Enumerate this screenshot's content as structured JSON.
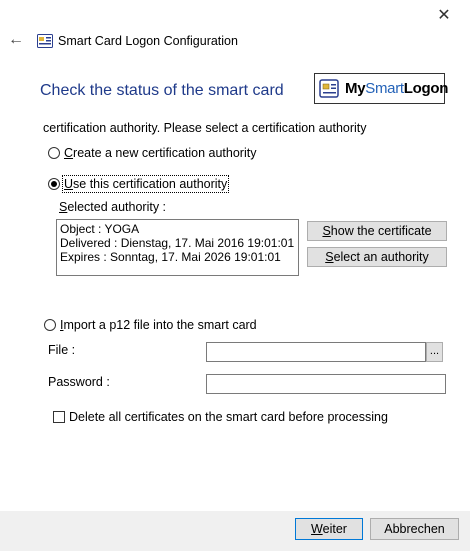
{
  "window": {
    "title": "Smart Card Logon Configuration",
    "close_glyph": "✕",
    "back_glyph": "←"
  },
  "header": {
    "heading": "Check the status of the smart card",
    "logo": {
      "my": "My",
      "smart": "Smart",
      "logon": "Logon"
    }
  },
  "intro_text": "certification authority. Please select a certification authority",
  "options": {
    "create_new": {
      "label": "Create a new certification authority",
      "checked": false
    },
    "use_this": {
      "label": "Use this certification authority",
      "checked": true
    },
    "import_p12": {
      "label": "Import a p12 file into the smart card",
      "checked": false
    }
  },
  "selected_authority": {
    "label": "Selected authority :",
    "lines": [
      "Object : YOGA",
      "Delivered : Dienstag, 17. Mai 2016 19:01:01",
      "Expires : Sonntag, 17. Mai 2026 19:01:01"
    ]
  },
  "buttons": {
    "show_certificate": "Show the certificate",
    "select_authority": "Select an authority",
    "browse": "...",
    "next": "Weiter",
    "cancel": "Abbrechen"
  },
  "import_fields": {
    "file_label": "File :",
    "file_value": "",
    "password_label": "Password :",
    "password_value": ""
  },
  "delete_option": {
    "label": "Delete all certificates on the smart card before processing",
    "checked": false
  },
  "colors": {
    "heading": "#1f3a8a",
    "logo_accent": "#2563b8",
    "primary_border": "#0078d7"
  }
}
